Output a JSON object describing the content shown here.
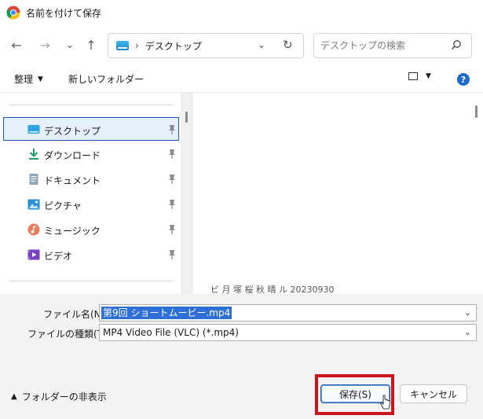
{
  "window": {
    "title": "名前を付けて保存"
  },
  "nav": {
    "back": "←",
    "forward": "→",
    "recent": "⌄",
    "up": "↑",
    "address_path": "デスクトップ",
    "address_separator": "›",
    "search_placeholder": "デスクトップの検索"
  },
  "toolbar": {
    "organize": "整理",
    "new_folder": "新しいフォルダー"
  },
  "sidebar": {
    "items": [
      {
        "label": "デスクトップ",
        "icon": "desktop-icon",
        "pinned": true,
        "selected": true
      },
      {
        "label": "ダウンロード",
        "icon": "download-icon",
        "pinned": true
      },
      {
        "label": "ドキュメント",
        "icon": "document-icon",
        "pinned": true
      },
      {
        "label": "ピクチャ",
        "icon": "pictures-icon",
        "pinned": true
      },
      {
        "label": "ミュージック",
        "icon": "music-icon",
        "pinned": true
      },
      {
        "label": "ビデオ",
        "icon": "video-icon",
        "pinned": true
      }
    ]
  },
  "content": {
    "peek_text": "ビ 月 塚 桜 秋 晴 ル  20230930"
  },
  "form": {
    "filename_label": "ファイル名(N):",
    "filename_value": "第9回 ショートムービー.mp4",
    "filetype_label": "ファイルの種類(T):",
    "filetype_value": "MP4 Video File (VLC) (*.mp4)"
  },
  "footer": {
    "hide_folders": "フォルダーの非表示",
    "save": "保存(S)",
    "cancel": "キャンセル"
  },
  "colors": {
    "accent": "#1e5aa8",
    "selection": "#2d6fd6",
    "highlight": "#c9151e"
  }
}
